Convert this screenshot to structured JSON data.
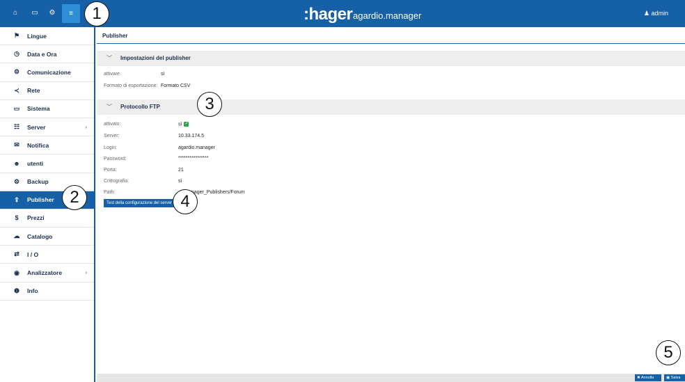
{
  "header": {
    "brand": ":hager",
    "brand_sub": "agardio.manager",
    "user": "admin",
    "icons": [
      "home-icon",
      "monitor-icon",
      "cogs-icon",
      "sliders-icon"
    ]
  },
  "sidebar": {
    "items": [
      {
        "label": "Lingue",
        "icon": "⚑"
      },
      {
        "label": "Data e Ora",
        "icon": "◷"
      },
      {
        "label": "Comunicazione",
        "icon": "⚙"
      },
      {
        "label": "Rete",
        "icon": "≺"
      },
      {
        "label": "Sistema",
        "icon": "▭"
      },
      {
        "label": "Server",
        "icon": "☷",
        "chev": "›"
      },
      {
        "label": "Notifica",
        "icon": "✉"
      },
      {
        "label": "utenti",
        "icon": "☻"
      },
      {
        "label": "Backup",
        "icon": "⚙"
      },
      {
        "label": "Publisher",
        "icon": "⇪"
      },
      {
        "label": "Prezzi",
        "icon": "$"
      },
      {
        "label": "Catalogo",
        "icon": "☁"
      },
      {
        "label": "I / O",
        "icon": "⇄"
      },
      {
        "label": "Analizzatore",
        "icon": "◉",
        "chev": "›"
      },
      {
        "label": "Info",
        "icon": "❶"
      }
    ]
  },
  "main": {
    "title": "Publisher",
    "section1": {
      "heading": "Impostazioni del publisher",
      "rows": [
        {
          "label": "attivare:",
          "value": "sì"
        },
        {
          "label": "Formato di esportazione:",
          "value": "Formato CSV"
        }
      ]
    },
    "section2": {
      "heading": "Protocollo FTP",
      "rows": [
        {
          "label": "attivato:",
          "value": "sì"
        },
        {
          "label": "Server:",
          "value": "10.33.174.5"
        },
        {
          "label": "Login:",
          "value": "agardio.manager"
        },
        {
          "label": "Password:",
          "value": "****************"
        },
        {
          "label": "Porta:",
          "value": "21"
        },
        {
          "label": "Crittografia:",
          "value": "sì"
        },
        {
          "label": "Path:",
          "value": "nager_Publishers/Forum"
        }
      ],
      "test_button": "Test della configurazione del server"
    }
  },
  "footer": {
    "cancel": "Annulla",
    "save": "Salva"
  },
  "callouts": [
    "1",
    "2",
    "3",
    "4",
    "5"
  ],
  "colors": {
    "brand_blue": "#1560a6",
    "check_green": "#2ca44a"
  }
}
